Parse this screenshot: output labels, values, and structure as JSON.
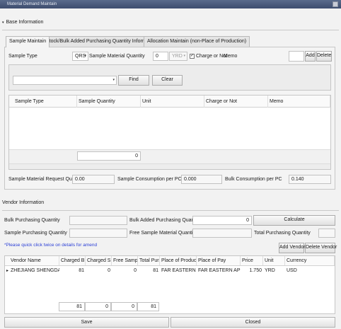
{
  "window": {
    "title": "Material Demand Maintain"
  },
  "base_info": {
    "header": "Base Information",
    "tabs": [
      {
        "label": "Sample Maintain"
      },
      {
        "label": "Stock/Bulk Added Purchasing Quantity Information"
      },
      {
        "label": "Allocation Maintain (non-Place of Production)"
      }
    ],
    "sample_type_label": "Sample Type",
    "sample_type_value": "QRS",
    "sample_material_qty_label": "Sample Material Quantity",
    "sample_material_qty_value": "0",
    "unit_value": "YRD",
    "charge_label": "Charge or Not",
    "memo_label": "Memo",
    "add_label": "Add",
    "delete_label": "Delete",
    "find_label": "Find",
    "clear_label": "Clear",
    "grid_columns": [
      "Sample Type",
      "Sample Quantity",
      "Unit",
      "Charge or Not",
      "Memo"
    ],
    "grid_total": "0",
    "request_qty_label": "Sample Material Request Quantity",
    "request_qty_value": "0.00",
    "consumption_label": "Sample Consumption per PC",
    "consumption_value": "0.000",
    "bulk_consumption_label": "Bulk Consumption per PC",
    "bulk_consumption_value": "0.140"
  },
  "vendor_info": {
    "header": "Vendor Information",
    "bulk_purchasing_label": "Bulk Purchasing Quantity",
    "bulk_added_label": "Bulk Added Purchasing Quantity",
    "bulk_added_value": "0",
    "calculate_label": "Calculate",
    "sample_purchasing_label": "Sample Purchasing Quantity",
    "free_sample_label": "Free Sample Material Quantity",
    "total_purchasing_label": "Total Purchasing Quantity",
    "note": "*Please quick click twice on details for amend",
    "add_vendor_label": "Add Vendor",
    "delete_vendor_label": "Delete Vendor",
    "grid_columns": [
      "Vendor Name",
      "Charged B...",
      "Charged S...",
      "Free Sampl...",
      "Total Pur...",
      "Place of Producti...",
      "Place of Pay",
      "Price",
      "Unit",
      "Currency"
    ],
    "rows": [
      [
        "ZHEJIANG SHENGDAN...",
        "81",
        "0",
        "0",
        "81",
        "FAR EASTERN AP...",
        "FAR EASTERN APPAR...",
        "1.750",
        "YRD",
        "USD"
      ]
    ],
    "row_marker": "▸",
    "totals": [
      "81",
      "0",
      "0",
      "81"
    ]
  },
  "footer": {
    "save_label": "Save",
    "close_label": "Closed"
  }
}
